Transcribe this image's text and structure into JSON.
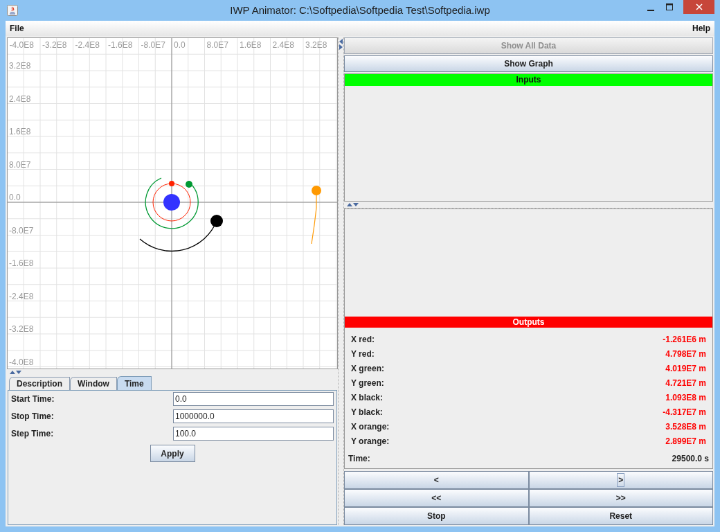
{
  "window": {
    "title": "IWP Animator: C:\\Softpedia\\Softpedia Test\\Softpedia.iwp"
  },
  "menu": [
    {
      "label": "File"
    },
    {
      "label": "Help"
    }
  ],
  "plot": {
    "x_labels": [
      "-4.0E8",
      "-3.2E8",
      "-2.4E8",
      "-1.6E8",
      "-8.0E7",
      "0.0",
      "8.0E7",
      "1.6E8",
      "2.4E8",
      "3.2E8"
    ],
    "y_labels": [
      "3.2E8",
      "2.4E8",
      "1.6E8",
      "8.0E7",
      "0.0",
      "-8.0E7",
      "-1.6E8",
      "-2.4E8",
      "-3.2E8",
      "-4.0E8"
    ]
  },
  "tabs": [
    {
      "label": "Description",
      "selected": false
    },
    {
      "label": "Window",
      "selected": false
    },
    {
      "label": "Time",
      "selected": true
    }
  ],
  "time_fields": [
    {
      "label": "Start Time:",
      "value": "0.0"
    },
    {
      "label": "Stop Time:",
      "value": "1000000.0"
    },
    {
      "label": "Step Time:",
      "value": "100.0"
    }
  ],
  "apply_button": "Apply",
  "top_buttons": [
    {
      "label": "Show All Data",
      "disabled": true
    },
    {
      "label": "Show Graph",
      "disabled": false
    }
  ],
  "inputs": {
    "title": "Inputs"
  },
  "outputs": {
    "title": "Outputs",
    "rows": [
      {
        "label": "X red:",
        "value": "-1.261E6 m"
      },
      {
        "label": "Y red:",
        "value": "4.798E7 m"
      },
      {
        "label": "X green:",
        "value": "4.019E7 m"
      },
      {
        "label": "Y green:",
        "value": "4.721E7 m"
      },
      {
        "label": "X black:",
        "value": "1.093E8 m"
      },
      {
        "label": "Y black:",
        "value": "-4.317E7 m"
      },
      {
        "label": "X orange:",
        "value": "3.528E8 m"
      },
      {
        "label": "Y orange:",
        "value": "2.899E7 m"
      }
    ],
    "time": {
      "label": "Time:",
      "value": "29500.0 s"
    }
  },
  "playback_buttons": [
    {
      "label": "<",
      "focused": false
    },
    {
      "label": ">",
      "focused": true
    },
    {
      "label": "<<",
      "focused": false
    },
    {
      "label": ">>",
      "focused": false
    },
    {
      "label": "Stop",
      "focused": false
    },
    {
      "label": "Reset",
      "focused": false
    }
  ]
}
